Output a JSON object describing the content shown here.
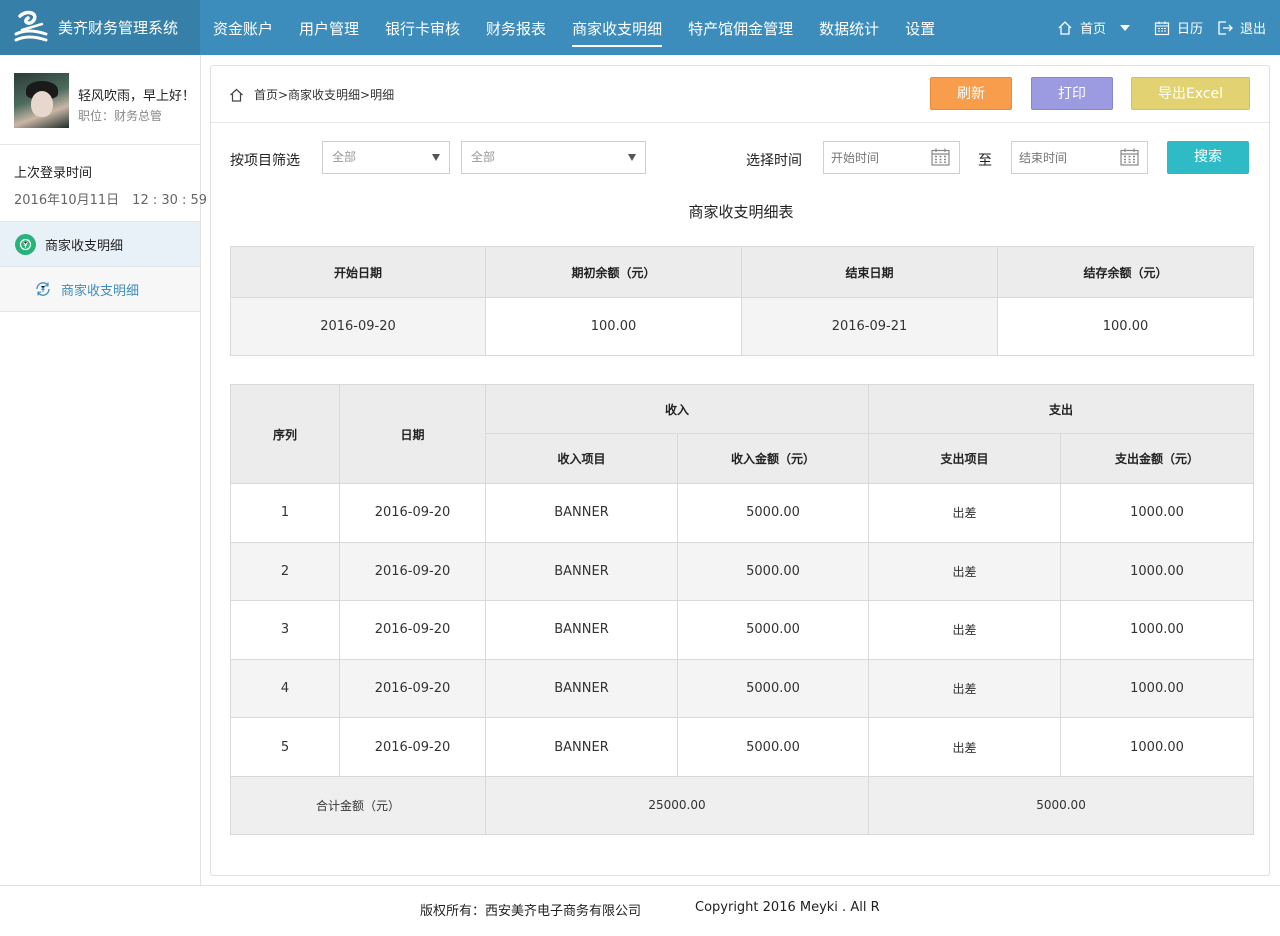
{
  "app": {
    "title": "美齐财务管理系统"
  },
  "nav": {
    "items": [
      {
        "label": "资金账户"
      },
      {
        "label": "用户管理"
      },
      {
        "label": "银行卡审核"
      },
      {
        "label": "财务报表"
      },
      {
        "label": "商家收支明细",
        "active": true
      },
      {
        "label": "特产馆佣金管理"
      },
      {
        "label": "数据统计"
      },
      {
        "label": "设置"
      }
    ],
    "home_label": "首页",
    "calendar_label": "日历",
    "logout_label": "退出"
  },
  "user": {
    "greeting": "轻风吹雨，早上好！",
    "position": "职位：财务总管",
    "last_login_label": "上次登录时间",
    "last_login_time": "2016年10月11日　12 : 30 : 59"
  },
  "sidebar": {
    "parent_label": "商家收支明细",
    "child_label": "商家收支明细"
  },
  "breadcrumb": "首页>商家收支明细>明细",
  "toolbar": {
    "refresh": "刷新",
    "print": "打印",
    "export": "导出Excel"
  },
  "filter": {
    "label": "按项目筛选",
    "select1": "全部",
    "select2": "全部",
    "time_label": "选择时间",
    "start_placeholder": "开始时间",
    "to_label": "至",
    "end_placeholder": "结束时间",
    "search": "搜索"
  },
  "report_title": "商家收支明细表",
  "summary": {
    "headers": [
      "开始日期",
      "期初余额（元）",
      "结束日期",
      "结存余额（元）"
    ],
    "row": [
      "2016-09-20",
      "100.00",
      "2016-09-21",
      "100.00"
    ]
  },
  "detail": {
    "seq_header": "序列",
    "date_header": "日期",
    "income_header": "收入",
    "expense_header": "支出",
    "income_item_header": "收入项目",
    "income_amount_header": "收入金额（元）",
    "expense_item_header": "支出项目",
    "expense_amount_header": "支出金额（元）",
    "rows": [
      [
        "1",
        "2016-09-20",
        "BANNER",
        "5000.00",
        "出差",
        "1000.00"
      ],
      [
        "2",
        "2016-09-20",
        "BANNER",
        "5000.00",
        "出差",
        "1000.00"
      ],
      [
        "3",
        "2016-09-20",
        "BANNER",
        "5000.00",
        "出差",
        "1000.00"
      ],
      [
        "4",
        "2016-09-20",
        "BANNER",
        "5000.00",
        "出差",
        "1000.00"
      ],
      [
        "5",
        "2016-09-20",
        "BANNER",
        "5000.00",
        "出差",
        "1000.00"
      ]
    ],
    "total_label": "合计金额（元）",
    "total_income": "25000.00",
    "total_expense": "5000.00"
  },
  "footer": {
    "copyright_cn": "版权所有：西安美齐电子商务有限公司",
    "copyright_en": "Copyright 2016 Meyki . All R"
  },
  "colors": {
    "topbar": "#3c8dbc",
    "refresh": "#f79d4c",
    "print": "#9c9ae0",
    "export": "#e2d271",
    "search": "#2ebbc6"
  }
}
